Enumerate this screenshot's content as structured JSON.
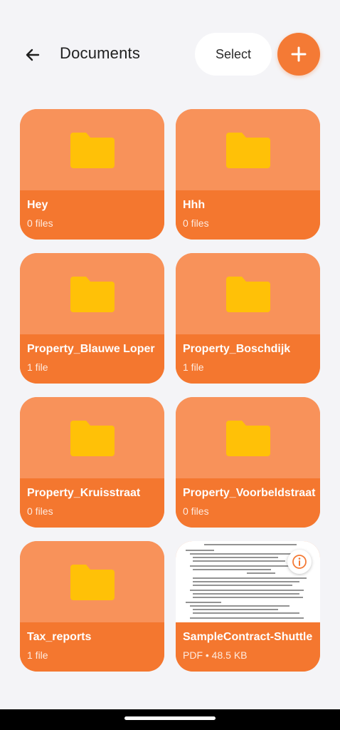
{
  "header": {
    "title": "Documents",
    "select_label": "Select",
    "back_icon": "arrow-left-icon",
    "add_icon": "plus-icon"
  },
  "colors": {
    "accent": "#f47a35",
    "folder": "#ffc107",
    "card_top": "#f8925a",
    "card_bottom": "#f4772f",
    "background": "#f4f4f7"
  },
  "items": [
    {
      "name": "Hey",
      "meta": "0 files",
      "type": "folder"
    },
    {
      "name": "Hhh",
      "meta": "0 files",
      "type": "folder"
    },
    {
      "name": "Property_Blauwe Loper",
      "meta": "1 file",
      "type": "folder"
    },
    {
      "name": "Property_Boschdijk",
      "meta": "1 file",
      "type": "folder"
    },
    {
      "name": "Property_Kruisstraat",
      "meta": "0 files",
      "type": "folder"
    },
    {
      "name": "Property_Voorbeldstraat",
      "meta": "0 files",
      "type": "folder"
    },
    {
      "name": "Tax_reports",
      "meta": "1 file",
      "type": "folder"
    },
    {
      "name": "SampleContract-Shuttle",
      "meta": "PDF • 48.5 KB",
      "type": "pdf"
    }
  ]
}
